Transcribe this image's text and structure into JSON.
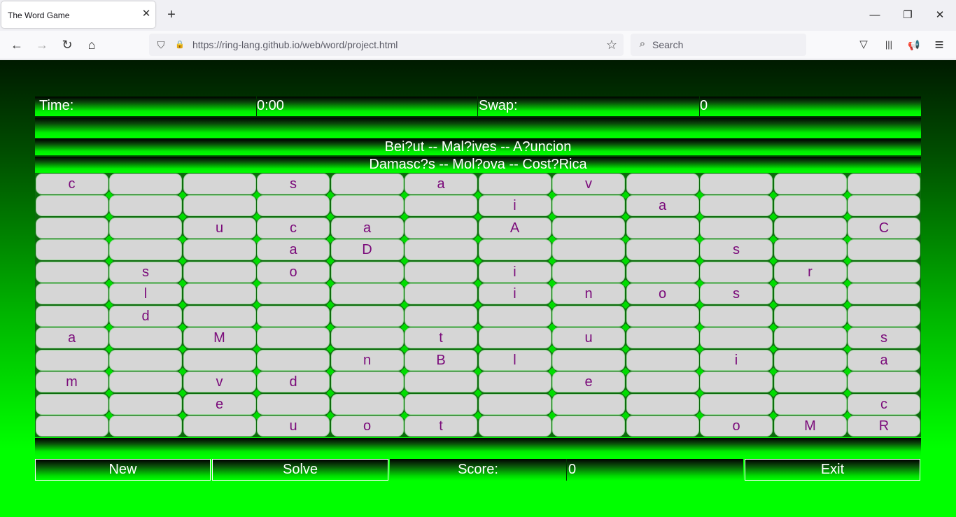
{
  "browser": {
    "tab_title": "The Word Game",
    "tab_close": "✕",
    "new_tab": "+",
    "url": "https://ring-lang.github.io/web/word/project.html",
    "search_placeholder": "Search",
    "window_minimize": "—",
    "window_restore": "❐",
    "window_close": "✕",
    "back": "←",
    "forward": "→",
    "reload": "↻",
    "home": "⌂",
    "shield": "⛉",
    "lock": "🔒",
    "star": "☆",
    "search_glyph": "⌕",
    "pocket": "▽",
    "library": "|||",
    "notify": "📢",
    "menu": "≡"
  },
  "game": {
    "time_label": "Time:",
    "time_value": "0:00",
    "swap_label": "Swap:",
    "swap_value": "0",
    "puzzle_line1": "Bei?ut -- Mal?ives -- A?uncion",
    "puzzle_line2": "Damasc?s -- Mol?ova -- Cost?Rica",
    "grid": [
      [
        "c",
        "",
        "",
        "s",
        "",
        "a",
        "",
        "v",
        "",
        "",
        "",
        ""
      ],
      [
        "",
        "",
        "",
        "",
        "",
        "",
        "i",
        "",
        "a",
        "",
        "",
        ""
      ],
      [
        "",
        "",
        "u",
        "c",
        "a",
        "",
        "A",
        "",
        "",
        "",
        "",
        "C"
      ],
      [
        "",
        "",
        "",
        "a",
        "D",
        "",
        "",
        "",
        "",
        "s",
        "",
        ""
      ],
      [
        "",
        "s",
        "",
        "o",
        "",
        "",
        "i",
        "",
        "",
        "",
        "r",
        ""
      ],
      [
        "",
        "l",
        "",
        "",
        "",
        "",
        "i",
        "n",
        "o",
        "s",
        "",
        ""
      ],
      [
        "",
        "d",
        "",
        "",
        "",
        "",
        "",
        "",
        "",
        "",
        "",
        ""
      ],
      [
        "a",
        "",
        "M",
        "",
        "",
        "t",
        "",
        "u",
        "",
        "",
        "",
        "s"
      ],
      [
        "",
        "",
        "",
        "",
        "n",
        "B",
        "l",
        "",
        "",
        "i",
        "",
        "a"
      ],
      [
        "m",
        "",
        "v",
        "d",
        "",
        "",
        "",
        "e",
        "",
        "",
        "",
        ""
      ],
      [
        "",
        "",
        "e",
        "",
        "",
        "",
        "",
        "",
        "",
        "",
        "",
        "c"
      ],
      [
        "",
        "",
        "",
        "u",
        "o",
        "t",
        "",
        "",
        "",
        "o",
        "M",
        "R"
      ]
    ],
    "new_label": "New",
    "solve_label": "Solve",
    "score_label": "Score:",
    "score_value": "0",
    "exit_label": "Exit"
  },
  "colors": {
    "cell_bg": "#d6d6d6",
    "letter": "#7a0a7a",
    "accent": "#00ff00"
  }
}
